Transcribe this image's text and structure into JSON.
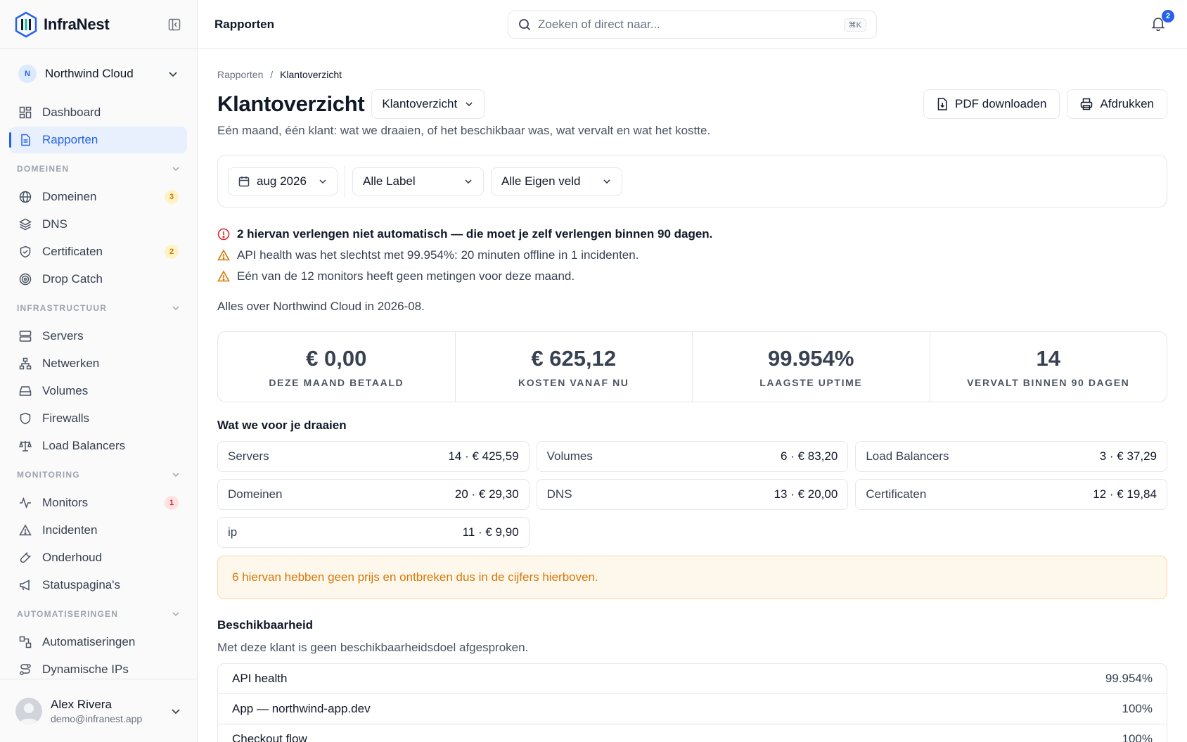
{
  "app": {
    "name": "InfraNest"
  },
  "org": {
    "initial": "N",
    "name": "Northwind Cloud"
  },
  "nav": {
    "top": [
      {
        "label": "Dashboard"
      },
      {
        "label": "Rapporten"
      }
    ],
    "sections": [
      {
        "title": "DOMEINEN",
        "items": [
          {
            "label": "Domeinen",
            "count": "3"
          },
          {
            "label": "DNS"
          },
          {
            "label": "Certificaten",
            "count": "2"
          },
          {
            "label": "Drop Catch"
          }
        ]
      },
      {
        "title": "INFRASTRUCTUUR",
        "items": [
          {
            "label": "Servers"
          },
          {
            "label": "Netwerken"
          },
          {
            "label": "Volumes"
          },
          {
            "label": "Firewalls"
          },
          {
            "label": "Load Balancers"
          }
        ]
      },
      {
        "title": "MONITORING",
        "items": [
          {
            "label": "Monitors",
            "count": "1"
          },
          {
            "label": "Incidenten"
          },
          {
            "label": "Onderhoud"
          },
          {
            "label": "Statuspagina's"
          }
        ]
      },
      {
        "title": "AUTOMATISERINGEN",
        "items": [
          {
            "label": "Automatiseringen"
          },
          {
            "label": "Dynamische IPs"
          }
        ]
      }
    ]
  },
  "user": {
    "name": "Alex Rivera",
    "email": "demo@infranest.app"
  },
  "topbar": {
    "title": "Rapporten",
    "search_placeholder": "Zoeken of direct naar...",
    "shortcut": "⌘K",
    "notifications": "2"
  },
  "breadcrumb": {
    "root": "Rapporten",
    "sep": "/",
    "current": "Klantoverzicht"
  },
  "page": {
    "title": "Klantoverzicht",
    "view_select": "Klantoverzicht",
    "pdf_button": "PDF downloaden",
    "print_button": "Afdrukken",
    "subtitle": "Eén maand, één klant: wat we draaien, of het beschikbaar was, wat vervalt en wat het kostte."
  },
  "filters": {
    "period": "aug 2026",
    "label": "Alle Label",
    "custom_field": "Alle Eigen veld"
  },
  "alerts": [
    {
      "type": "error",
      "text": "2 hiervan verlengen niet automatisch — die moet je zelf verlengen binnen 90 dagen."
    },
    {
      "type": "warning",
      "text": "API health was het slechtst met 99.954%: 20 minuten offline in 1 incidenten."
    },
    {
      "type": "warning",
      "text": "Eén van de 12 monitors heeft geen metingen voor deze maand."
    }
  ],
  "about": "Alles over Northwind Cloud in 2026-08.",
  "kpis": [
    {
      "value": "€ 0,00",
      "label": "DEZE MAAND BETAALD"
    },
    {
      "value": "€ 625,12",
      "label": "KOSTEN VANAF NU"
    },
    {
      "value": "99.954%",
      "label": "LAAGSTE UPTIME"
    },
    {
      "value": "14",
      "label": "VERVALT BINNEN 90 DAGEN"
    }
  ],
  "running": {
    "title": "Wat we voor je draaien",
    "items": [
      {
        "name": "Servers",
        "value": "14 · € 425,59"
      },
      {
        "name": "Volumes",
        "value": "6 · € 83,20"
      },
      {
        "name": "Load Balancers",
        "value": "3 · € 37,29"
      },
      {
        "name": "Domeinen",
        "value": "20 · € 29,30"
      },
      {
        "name": "DNS",
        "value": "13 · € 20,00"
      },
      {
        "name": "Certificaten",
        "value": "12 · € 19,84"
      },
      {
        "name": "ip",
        "value": "11 · € 9,90"
      }
    ],
    "notice": "6 hiervan hebben geen prijs en ontbreken dus in de cijfers hierboven."
  },
  "availability": {
    "title": "Beschikbaarheid",
    "subtitle": "Met deze klant is geen beschikbaarheidsdoel afgesproken.",
    "rows": [
      {
        "name": "API health",
        "value": "99.954%"
      },
      {
        "name": "App — northwind-app.dev",
        "value": "100%"
      },
      {
        "name": "Checkout flow",
        "value": "100%"
      }
    ]
  },
  "colors": {
    "accent": "#2563eb",
    "warning": "#d97706",
    "error": "#dc2626"
  }
}
